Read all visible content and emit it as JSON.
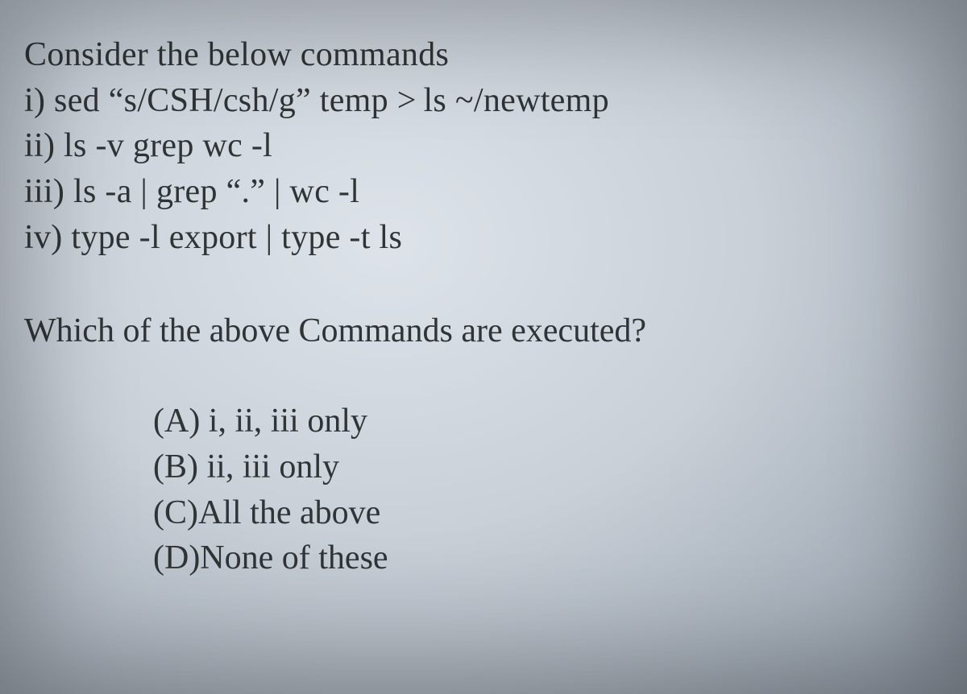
{
  "heading": "Consider the below commands",
  "commands": {
    "i": "i) sed “s/CSH/csh/g” temp > ls ~/newtemp",
    "ii": "ii) ls -v grep wc -l",
    "iii": "iii) ls -a | grep  “.” | wc -l",
    "iv": "iv) type -l export | type -t ls"
  },
  "question": "Which of the above Commands are executed?",
  "options": {
    "a": "(A) i, ii, iii only",
    "b": "(B) ii, iii  only",
    "c": "(C)All the above",
    "d": "(D)None of these"
  }
}
